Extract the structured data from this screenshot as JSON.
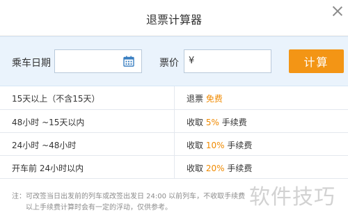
{
  "dialog": {
    "title": "退票计算器"
  },
  "form": {
    "date_label": "乘车日期",
    "date_value": "",
    "price_label": "票价",
    "currency": "¥",
    "price_value": "",
    "calc_button": "计算"
  },
  "fee_table": [
    {
      "period": "15天以上（不含15天）",
      "fee_prefix": "退票 ",
      "fee_highlight": "免费",
      "fee_suffix": ""
    },
    {
      "period": "48小时 ~15天以内",
      "fee_prefix": "收取 ",
      "fee_highlight": "5%",
      "fee_suffix": " 手续费"
    },
    {
      "period": "24小时 ~48小时",
      "fee_prefix": "收取 ",
      "fee_highlight": "10%",
      "fee_suffix": " 手续费"
    },
    {
      "period": "开车前 24小时以内",
      "fee_prefix": "收取 ",
      "fee_highlight": "20%",
      "fee_suffix": " 手续费"
    }
  ],
  "note": {
    "line1": "注：可改签当日出发前的列车或改签出发日 24:00 以前列车，不收取手续费",
    "line2": "以上手续费计算时会有一定的浮动，仅供参考。"
  },
  "watermark": "软件技巧",
  "colors": {
    "accent_orange": "#f39515",
    "highlight_text": "#f08a00",
    "form_band": "#eaf3fc"
  }
}
